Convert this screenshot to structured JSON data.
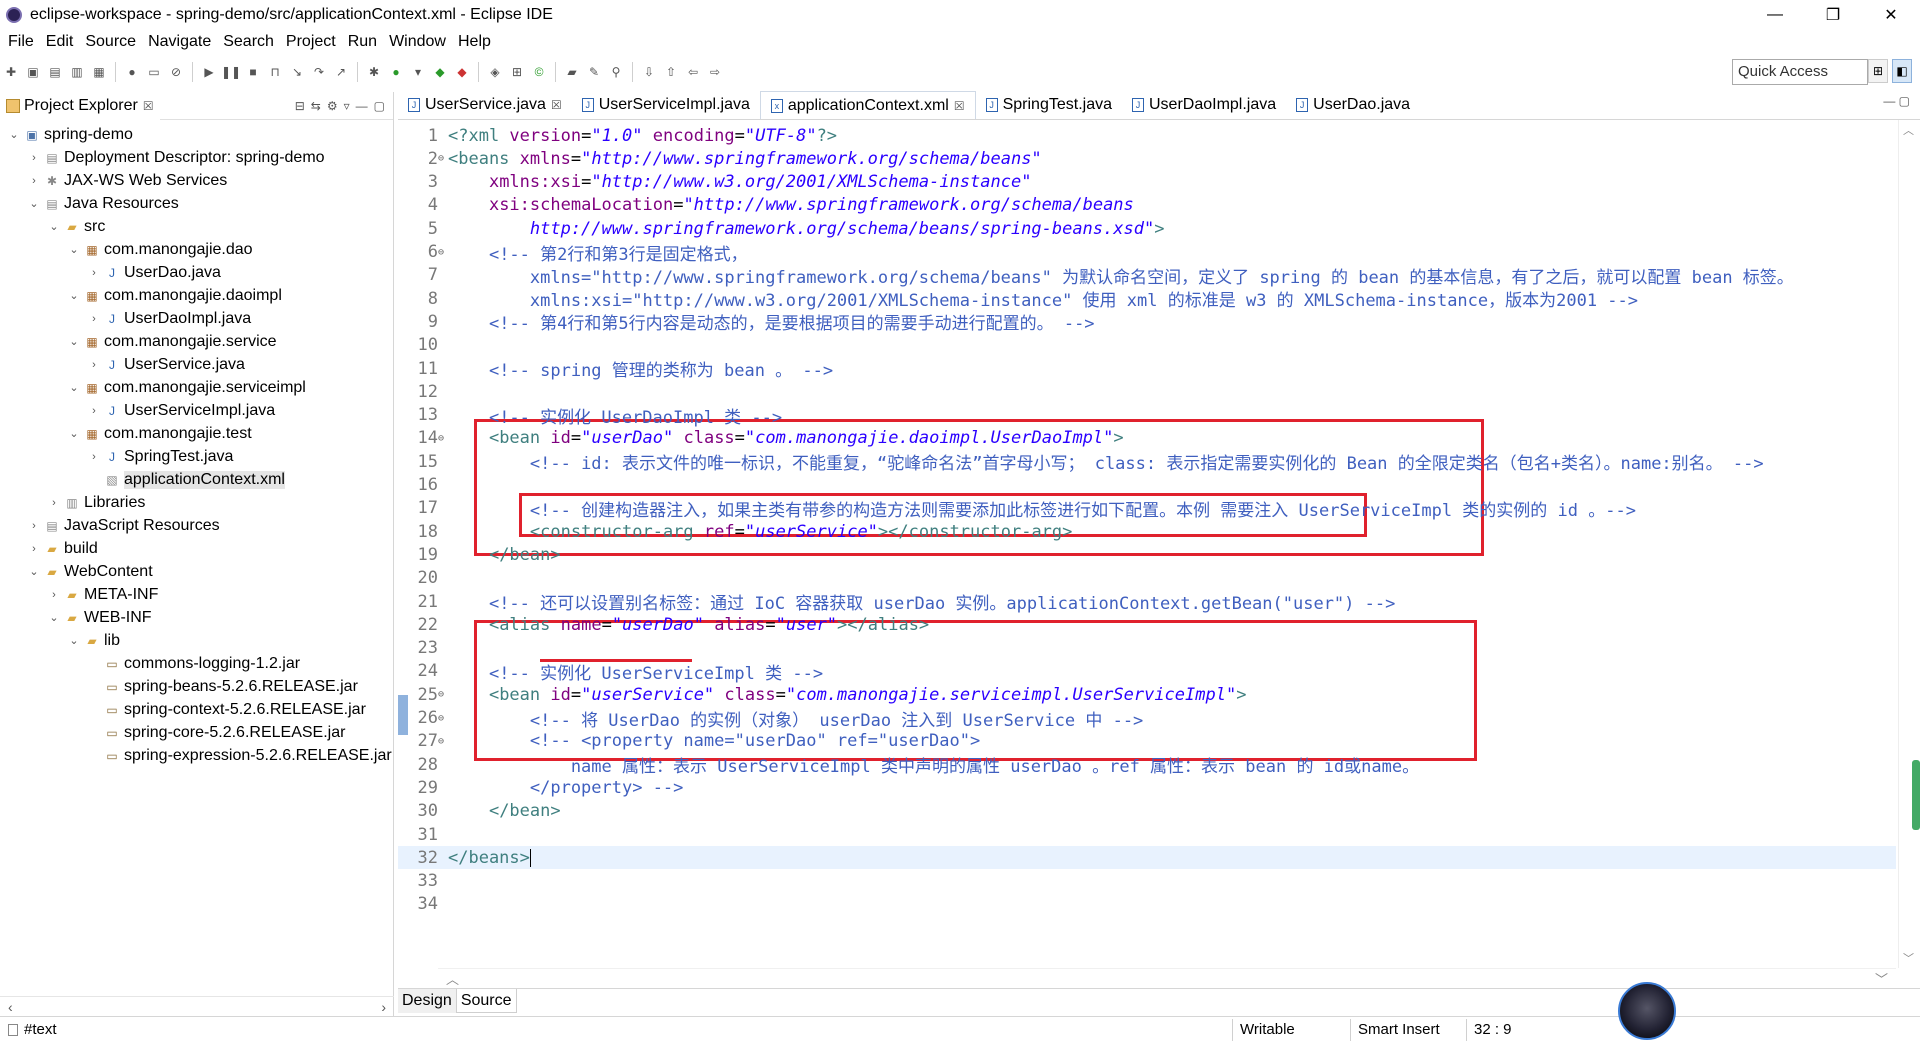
{
  "window": {
    "title": "eclipse-workspace - spring-demo/src/applicationContext.xml - Eclipse IDE",
    "controls": {
      "minimize": "—",
      "restore": "❐",
      "close": "✕"
    }
  },
  "menu": [
    "File",
    "Edit",
    "Source",
    "Navigate",
    "Search",
    "Project",
    "Run",
    "Window",
    "Help"
  ],
  "quick_access": "Quick Access",
  "explorer": {
    "title": "Project Explorer",
    "close": "☒",
    "tree": [
      {
        "label": "spring-demo",
        "depth": 0,
        "twisty": "v",
        "icon": "project-icon",
        "glyph": "▣"
      },
      {
        "label": "Deployment Descriptor: spring-demo",
        "depth": 1,
        "twisty": ">",
        "icon": "descriptor-icon",
        "glyph": "▤"
      },
      {
        "label": "JAX-WS Web Services",
        "depth": 1,
        "twisty": ">",
        "icon": "webservice-icon",
        "glyph": "✱"
      },
      {
        "label": "Java Resources",
        "depth": 1,
        "twisty": "v",
        "icon": "java-resources-icon",
        "glyph": "▤"
      },
      {
        "label": "src",
        "depth": 2,
        "twisty": "v",
        "icon": "source-folder-icon",
        "glyph": "▰"
      },
      {
        "label": "com.manongajie.dao",
        "depth": 3,
        "twisty": "v",
        "icon": "package-icon",
        "glyph": "▦"
      },
      {
        "label": "UserDao.java",
        "depth": 4,
        "twisty": ">",
        "icon": "java-file-icon",
        "glyph": "J"
      },
      {
        "label": "com.manongajie.daoimpl",
        "depth": 3,
        "twisty": "v",
        "icon": "package-icon",
        "glyph": "▦"
      },
      {
        "label": "UserDaoImpl.java",
        "depth": 4,
        "twisty": ">",
        "icon": "java-file-icon",
        "glyph": "J"
      },
      {
        "label": "com.manongajie.service",
        "depth": 3,
        "twisty": "v",
        "icon": "package-icon",
        "glyph": "▦"
      },
      {
        "label": "UserService.java",
        "depth": 4,
        "twisty": ">",
        "icon": "java-file-icon",
        "glyph": "J"
      },
      {
        "label": "com.manongajie.serviceimpl",
        "depth": 3,
        "twisty": "v",
        "icon": "package-icon",
        "glyph": "▦"
      },
      {
        "label": "UserServiceImpl.java",
        "depth": 4,
        "twisty": ">",
        "icon": "java-file-icon",
        "glyph": "J"
      },
      {
        "label": "com.manongajie.test",
        "depth": 3,
        "twisty": "v",
        "icon": "package-icon",
        "glyph": "▦"
      },
      {
        "label": "SpringTest.java",
        "depth": 4,
        "twisty": ">",
        "icon": "java-file-icon",
        "glyph": "J"
      },
      {
        "label": "applicationContext.xml",
        "depth": 4,
        "twisty": "",
        "icon": "xml-file-icon",
        "glyph": "▧",
        "selected": true
      },
      {
        "label": "Libraries",
        "depth": 2,
        "twisty": ">",
        "icon": "libraries-icon",
        "glyph": "▥"
      },
      {
        "label": "JavaScript Resources",
        "depth": 1,
        "twisty": ">",
        "icon": "js-resources-icon",
        "glyph": "▤"
      },
      {
        "label": "build",
        "depth": 1,
        "twisty": ">",
        "icon": "folder-icon",
        "glyph": "▰"
      },
      {
        "label": "WebContent",
        "depth": 1,
        "twisty": "v",
        "icon": "folder-icon",
        "glyph": "▰"
      },
      {
        "label": "META-INF",
        "depth": 2,
        "twisty": ">",
        "icon": "folder-icon",
        "glyph": "▰"
      },
      {
        "label": "WEB-INF",
        "depth": 2,
        "twisty": "v",
        "icon": "folder-icon",
        "glyph": "▰"
      },
      {
        "label": "lib",
        "depth": 3,
        "twisty": "v",
        "icon": "folder-icon",
        "glyph": "▰"
      },
      {
        "label": "commons-logging-1.2.jar",
        "depth": 4,
        "twisty": "",
        "icon": "jar-icon",
        "glyph": "▭"
      },
      {
        "label": "spring-beans-5.2.6.RELEASE.jar",
        "depth": 4,
        "twisty": "",
        "icon": "jar-icon",
        "glyph": "▭"
      },
      {
        "label": "spring-context-5.2.6.RELEASE.jar",
        "depth": 4,
        "twisty": "",
        "icon": "jar-icon",
        "glyph": "▭"
      },
      {
        "label": "spring-core-5.2.6.RELEASE.jar",
        "depth": 4,
        "twisty": "",
        "icon": "jar-icon",
        "glyph": "▭"
      },
      {
        "label": "spring-expression-5.2.6.RELEASE.jar",
        "depth": 4,
        "twisty": "",
        "icon": "jar-icon",
        "glyph": "▭"
      }
    ]
  },
  "editor": {
    "tabs": [
      {
        "label": "UserService.java",
        "close": "☒"
      },
      {
        "label": "UserServiceImpl.java",
        "close": ""
      },
      {
        "label": "applicationContext.xml",
        "close": "☒",
        "active": true
      },
      {
        "label": "SpringTest.java",
        "close": ""
      },
      {
        "label": "UserDaoImpl.java",
        "close": ""
      },
      {
        "label": "UserDao.java",
        "close": ""
      }
    ],
    "current_line": 32,
    "lines": [
      {
        "n": "1",
        "fold": "",
        "tokens": [
          [
            "decl",
            "<?xml "
          ],
          [
            "attr",
            "version"
          ],
          [
            "text",
            "="
          ],
          [
            "val",
            "\"1.0\""
          ],
          [
            "text",
            " "
          ],
          [
            "attr",
            "encoding"
          ],
          [
            "text",
            "="
          ],
          [
            "val",
            "\"UTF-8\""
          ],
          [
            "decl",
            "?>"
          ]
        ]
      },
      {
        "n": "2",
        "fold": "⊖",
        "tokens": [
          [
            "tag",
            "<beans "
          ],
          [
            "attr",
            "xmlns"
          ],
          [
            "text",
            "="
          ],
          [
            "val",
            "\"http://www.springframework.org/schema/beans\""
          ]
        ]
      },
      {
        "n": "3",
        "fold": "",
        "tokens": [
          [
            "text",
            "    "
          ],
          [
            "attr",
            "xmlns:xsi"
          ],
          [
            "text",
            "="
          ],
          [
            "val",
            "\"http://www.w3.org/2001/XMLSchema-instance\""
          ]
        ]
      },
      {
        "n": "4",
        "fold": "",
        "tokens": [
          [
            "text",
            "    "
          ],
          [
            "attr",
            "xsi:schemaLocation"
          ],
          [
            "text",
            "="
          ],
          [
            "val",
            "\"http://www.springframework.org/schema/beans"
          ]
        ]
      },
      {
        "n": "5",
        "fold": "",
        "tokens": [
          [
            "val",
            "        http://www.springframework.org/schema/beans/spring-beans.xsd\""
          ],
          [
            "tag",
            ">"
          ]
        ]
      },
      {
        "n": "6",
        "fold": "⊖",
        "tokens": [
          [
            "text",
            "    "
          ],
          [
            "com",
            "<!-- 第2行和第3行是固定格式，"
          ]
        ]
      },
      {
        "n": "7",
        "fold": "",
        "tokens": [
          [
            "com",
            "        xmlns=\"http://www.springframework.org/schema/beans\" 为默认命名空间，定义了 spring 的 bean 的基本信息，有了之后，就可以配置 bean 标签。"
          ]
        ]
      },
      {
        "n": "8",
        "fold": "",
        "tokens": [
          [
            "com",
            "        xmlns:xsi=\"http://www.w3.org/2001/XMLSchema-instance\" 使用 xml 的标准是 w3 的 XMLSchema-instance，版本为2001 -->"
          ]
        ]
      },
      {
        "n": "9",
        "fold": "",
        "tokens": [
          [
            "text",
            "    "
          ],
          [
            "com",
            "<!-- 第4行和第5行内容是动态的，是要根据项目的需要手动进行配置的。 -->"
          ]
        ]
      },
      {
        "n": "10",
        "fold": "",
        "tokens": []
      },
      {
        "n": "11",
        "fold": "",
        "tokens": [
          [
            "text",
            "    "
          ],
          [
            "com",
            "<!-- spring 管理的类称为 bean 。 -->"
          ]
        ]
      },
      {
        "n": "12",
        "fold": "",
        "tokens": []
      },
      {
        "n": "13",
        "fold": "",
        "tokens": [
          [
            "text",
            "    "
          ],
          [
            "com",
            "<!-- 实例化 UserDaoImpl 类 -->"
          ]
        ]
      },
      {
        "n": "14",
        "fold": "⊖",
        "tokens": [
          [
            "text",
            "    "
          ],
          [
            "tag",
            "<bean "
          ],
          [
            "attr",
            "id"
          ],
          [
            "text",
            "="
          ],
          [
            "val",
            "\"userDao\""
          ],
          [
            "text",
            " "
          ],
          [
            "attr",
            "class"
          ],
          [
            "text",
            "="
          ],
          [
            "val",
            "\"com.manongajie.daoimpl.UserDaoImpl\""
          ],
          [
            "tag",
            ">"
          ]
        ]
      },
      {
        "n": "15",
        "fold": "",
        "tokens": [
          [
            "text",
            "        "
          ],
          [
            "com",
            "<!-- id: 表示文件的唯一标识，不能重复，“驼峰命名法”首字母小写； class: 表示指定需要实例化的 Bean 的全限定类名（包名+类名）。name:别名。 -->"
          ]
        ]
      },
      {
        "n": "16",
        "fold": "",
        "tokens": []
      },
      {
        "n": "17",
        "fold": "",
        "tokens": [
          [
            "text",
            "        "
          ],
          [
            "com",
            "<!-- 创建构造器注入，如果主类有带参的构造方法则需要添加此标签进行如下配置。本例 需要注入 UserServiceImpl 类的实例的 id 。-->"
          ]
        ]
      },
      {
        "n": "18",
        "fold": "",
        "tokens": [
          [
            "text",
            "        "
          ],
          [
            "tag",
            "<constructor-arg "
          ],
          [
            "attr",
            "ref"
          ],
          [
            "text",
            "="
          ],
          [
            "val",
            "\"userService\""
          ],
          [
            "tag",
            "></constructor-arg>"
          ]
        ]
      },
      {
        "n": "19",
        "fold": "",
        "tokens": [
          [
            "text",
            "    "
          ],
          [
            "tag",
            "</bean>"
          ]
        ]
      },
      {
        "n": "20",
        "fold": "",
        "tokens": []
      },
      {
        "n": "21",
        "fold": "",
        "tokens": [
          [
            "text",
            "    "
          ],
          [
            "com",
            "<!-- 还可以设置别名标签：通过 IoC 容器获取 userDao 实例。applicationContext.getBean(\"user\") -->"
          ]
        ]
      },
      {
        "n": "22",
        "fold": "",
        "tokens": [
          [
            "text",
            "    "
          ],
          [
            "tag",
            "<alias "
          ],
          [
            "attr",
            "name"
          ],
          [
            "text",
            "="
          ],
          [
            "val",
            "\"userDao\""
          ],
          [
            "text",
            " "
          ],
          [
            "attr",
            "alias"
          ],
          [
            "text",
            "="
          ],
          [
            "val",
            "\"user\""
          ],
          [
            "tag",
            "></alias>"
          ]
        ]
      },
      {
        "n": "23",
        "fold": "",
        "tokens": []
      },
      {
        "n": "24",
        "fold": "",
        "tokens": [
          [
            "text",
            "    "
          ],
          [
            "com",
            "<!-- 实例化 UserServiceImpl 类 -->"
          ]
        ]
      },
      {
        "n": "25",
        "fold": "⊖",
        "tokens": [
          [
            "text",
            "    "
          ],
          [
            "tag",
            "<bean "
          ],
          [
            "attr",
            "id"
          ],
          [
            "text",
            "="
          ],
          [
            "val",
            "\"userService\""
          ],
          [
            "text",
            " "
          ],
          [
            "attr",
            "class"
          ],
          [
            "text",
            "="
          ],
          [
            "val",
            "\"com.manongajie.serviceimpl.UserServiceImpl\""
          ],
          [
            "tag",
            ">"
          ]
        ]
      },
      {
        "n": "26",
        "fold": "⊖",
        "tokens": [
          [
            "text",
            "        "
          ],
          [
            "com",
            "<!-- 将 UserDao 的实例（对象） userDao 注入到 UserService 中 -->"
          ]
        ]
      },
      {
        "n": "27",
        "fold": "⊖",
        "tokens": [
          [
            "text",
            "        "
          ],
          [
            "com",
            "<!-- <property name=\"userDao\" ref=\"userDao\">"
          ]
        ]
      },
      {
        "n": "28",
        "fold": "",
        "tokens": [
          [
            "com",
            "            name 属性：表示 UserServiceImpl 类中声明的属性 userDao 。ref 属性：表示 bean 的 id或name。"
          ]
        ]
      },
      {
        "n": "29",
        "fold": "",
        "tokens": [
          [
            "com",
            "        </property> -->"
          ]
        ]
      },
      {
        "n": "30",
        "fold": "",
        "tokens": [
          [
            "text",
            "    "
          ],
          [
            "tag",
            "</bean>"
          ]
        ]
      },
      {
        "n": "31",
        "fold": "",
        "tokens": []
      },
      {
        "n": "32",
        "fold": "",
        "tokens": [
          [
            "tag",
            "</beans>"
          ]
        ]
      },
      {
        "n": "33",
        "fold": "",
        "tokens": []
      },
      {
        "n": "34",
        "fold": "",
        "tokens": []
      }
    ],
    "mode_tabs": {
      "design": "Design",
      "source": "Source"
    }
  },
  "status": {
    "left": "#text",
    "writable": "Writable",
    "insert_mode": "Smart Insert",
    "position": "32 : 9"
  },
  "colors": {
    "highlight_box": "#e0212d",
    "xml_tag": "#3f7f7f",
    "xml_attr": "#7f007f",
    "xml_value": "#2a00ff",
    "xml_comment": "#3f5fbf",
    "current_line": "#e8f2fe"
  }
}
